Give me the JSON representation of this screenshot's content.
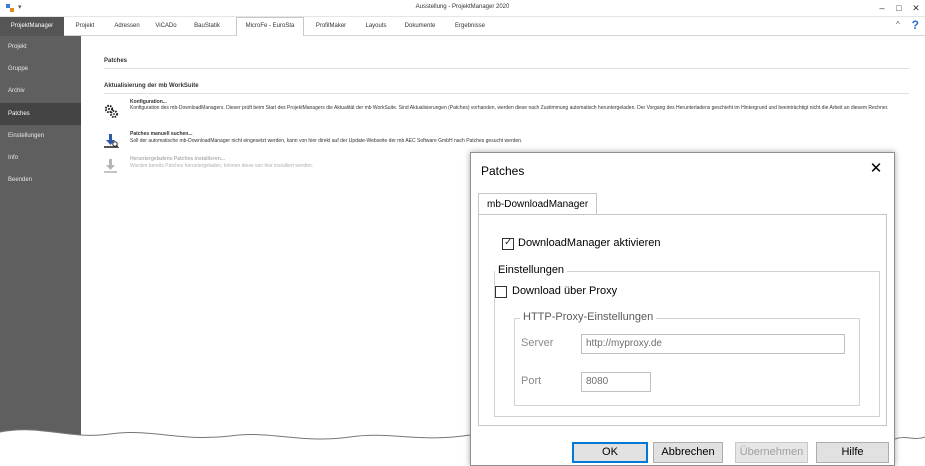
{
  "window": {
    "title": "Ausstellung - ProjektManager 2020",
    "quick_access_arrow": "▾",
    "minimize": "–",
    "maximize": "□",
    "close": "✕"
  },
  "ribbon": {
    "tabs": [
      {
        "label": "ProjektManager"
      },
      {
        "label": "Projekt"
      },
      {
        "label": "Adressen"
      },
      {
        "label": "ViCADo"
      },
      {
        "label": "BauStatik"
      },
      {
        "label": "MicroFe - EuroSta"
      },
      {
        "label": "ProfilMaker"
      },
      {
        "label": "Layouts"
      },
      {
        "label": "Dokumente"
      },
      {
        "label": "Ergebnisse"
      }
    ],
    "collapse": "^",
    "help": "?"
  },
  "sidebar": {
    "items": [
      {
        "label": "Projekt"
      },
      {
        "label": "Gruppe"
      },
      {
        "label": "Archiv"
      },
      {
        "label": "Patches"
      },
      {
        "label": "Einstellungen"
      },
      {
        "label": "Info"
      },
      {
        "label": "Beenden"
      }
    ]
  },
  "main": {
    "heading": "Patches",
    "subheading": "Aktualisierung der mb WorkSuite",
    "entries": [
      {
        "title": "Konfiguration...",
        "desc": "Konfiguration des mb-DownloadManagers. Dieser prüft beim Start des ProjektManagers die Aktualität der mb WorkSuite. Sind Aktualisierungen (Patches) vorhanden, werden diese nach Zustimmung automatisch heruntergeladen. Der Vorgang des Herunterladens geschieht im Hintergrund und beeinträchtigt nicht die Arbeit an diesem Rechner."
      },
      {
        "title": "Patches manuell suchen...",
        "desc": "Soll der automatische mb-DownloadManager nicht eingesetzt werden, kann von hier direkt auf der Update-Webseite der mb AEC Software GmbH nach Patches gesucht werden."
      },
      {
        "title": "Heruntergeladene Patches installieren...",
        "desc": "Wurden bereits Patches heruntergeladen, können diese von hier installiert werden."
      }
    ]
  },
  "dialog": {
    "title": "Patches",
    "close": "✕",
    "tab": "mb-DownloadManager",
    "activate_label": "DownloadManager aktivieren",
    "activate_checked": true,
    "settings_group": "Einstellungen",
    "proxy_label": "Download über Proxy",
    "proxy_checked": false,
    "proxy_group": "HTTP-Proxy-Einstellungen",
    "server_label": "Server",
    "server_value": "http://myproxy.de",
    "port_label": "Port",
    "port_value": "8080",
    "buttons": {
      "ok": "OK",
      "cancel": "Abbrechen",
      "apply": "Übernehmen",
      "help": "Hilfe"
    }
  },
  "colors": {
    "sidebar_bg": "#5f5f5f",
    "sidebar_selected": "#444444",
    "active_tab": "#555555",
    "default_button_border": "#0078d7"
  }
}
